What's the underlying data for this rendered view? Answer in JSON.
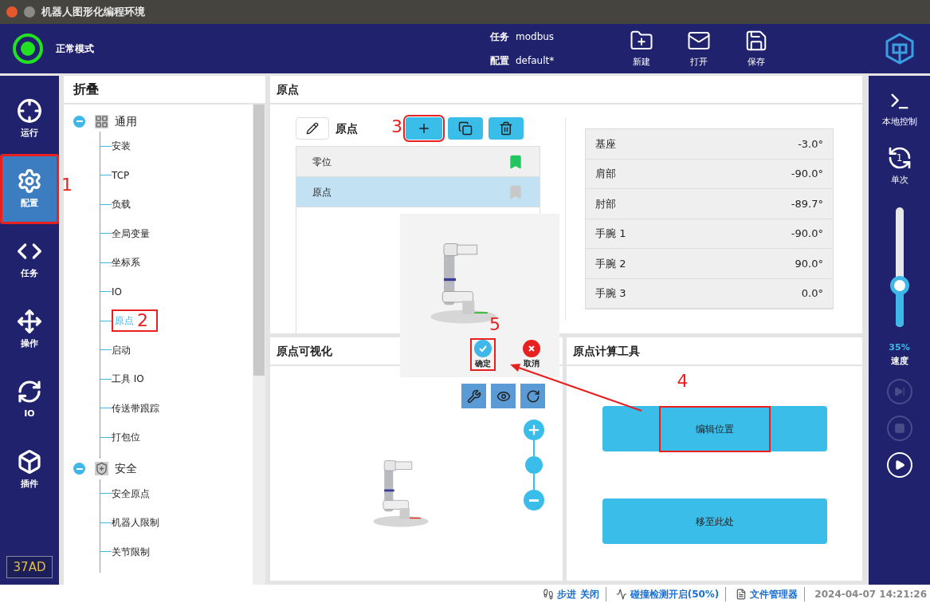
{
  "window": {
    "title": "机器人图形化编程环境"
  },
  "header": {
    "mode": "正常模式",
    "task_label": "任务",
    "task": "modbus",
    "config_label": "配置",
    "config": "default*",
    "actions": [
      {
        "kind": "new",
        "label": "新建"
      },
      {
        "kind": "open",
        "label": "打开"
      },
      {
        "kind": "save",
        "label": "保存"
      }
    ]
  },
  "nav": {
    "items": [
      {
        "kind": "run",
        "label": "运行",
        "selected": false
      },
      {
        "kind": "config",
        "label": "配置",
        "selected": true,
        "callout": "1"
      },
      {
        "kind": "task",
        "label": "任务",
        "selected": false
      },
      {
        "kind": "move",
        "label": "操作",
        "selected": false
      },
      {
        "kind": "io",
        "label": "IO",
        "selected": false
      },
      {
        "kind": "plugin",
        "label": "插件",
        "selected": false
      }
    ],
    "badge": "37AD"
  },
  "tree": {
    "title": "折叠",
    "groups": [
      {
        "kind": "general",
        "label": "通用",
        "expanded": true,
        "children": [
          {
            "label": "安装",
            "selected": false
          },
          {
            "label": "TCP",
            "selected": false
          },
          {
            "label": "负载",
            "selected": false
          },
          {
            "label": "全局变量",
            "selected": false
          },
          {
            "label": "坐标系",
            "selected": false
          },
          {
            "label": "IO",
            "selected": false
          },
          {
            "label": "原点",
            "selected": true,
            "callout": "2"
          },
          {
            "label": "启动",
            "selected": false
          },
          {
            "label": "工具 IO",
            "selected": false
          },
          {
            "label": "传送带跟踪",
            "selected": false
          },
          {
            "label": "打包位",
            "selected": false
          }
        ]
      },
      {
        "kind": "safety",
        "label": "安全",
        "expanded": true,
        "children": [
          {
            "label": "安全原点",
            "selected": false
          },
          {
            "label": "机器人限制",
            "selected": false
          },
          {
            "label": "关节限制",
            "selected": false
          }
        ]
      }
    ]
  },
  "origin_panel": {
    "title": "原点",
    "name": "原点",
    "add_callout": "3",
    "points": [
      {
        "label": "零位",
        "selected": false,
        "default": true
      },
      {
        "label": "原点",
        "selected": true,
        "default": false
      }
    ],
    "joints": [
      {
        "name": "基座",
        "value": "-3.0°"
      },
      {
        "name": "肩部",
        "value": "-90.0°"
      },
      {
        "name": "肘部",
        "value": "-89.7°"
      },
      {
        "name": "手腕 1",
        "value": "-90.0°"
      },
      {
        "name": "手腕 2",
        "value": "90.0°"
      },
      {
        "name": "手腕 3",
        "value": "0.0°"
      }
    ]
  },
  "popup": {
    "confirm": "确定",
    "cancel": "取消",
    "callout": "5"
  },
  "visual_panel": {
    "title": "原点可视化"
  },
  "tool_panel": {
    "title": "原点计算工具",
    "buttons": [
      {
        "label": "编辑位置",
        "callout": "4"
      },
      {
        "label": "移至此处"
      }
    ]
  },
  "right_bar": {
    "local_label": "本地控制",
    "cycle_number": "1",
    "cycle_label": "单次",
    "speed": {
      "level": 0.35,
      "reading": "35%",
      "label": "速度"
    },
    "controls": [
      {
        "kind": "step",
        "disabled": true
      },
      {
        "kind": "stop",
        "disabled": true
      },
      {
        "kind": "play",
        "disabled": false
      }
    ]
  },
  "status_bar": {
    "items": [
      {
        "kind": "step",
        "label": "步进 关闭"
      },
      {
        "kind": "collision",
        "label": "碰撞检测开启(50%)"
      },
      {
        "kind": "files",
        "label": "文件管理器"
      }
    ],
    "time": "2024-04-07 14:21:26"
  }
}
